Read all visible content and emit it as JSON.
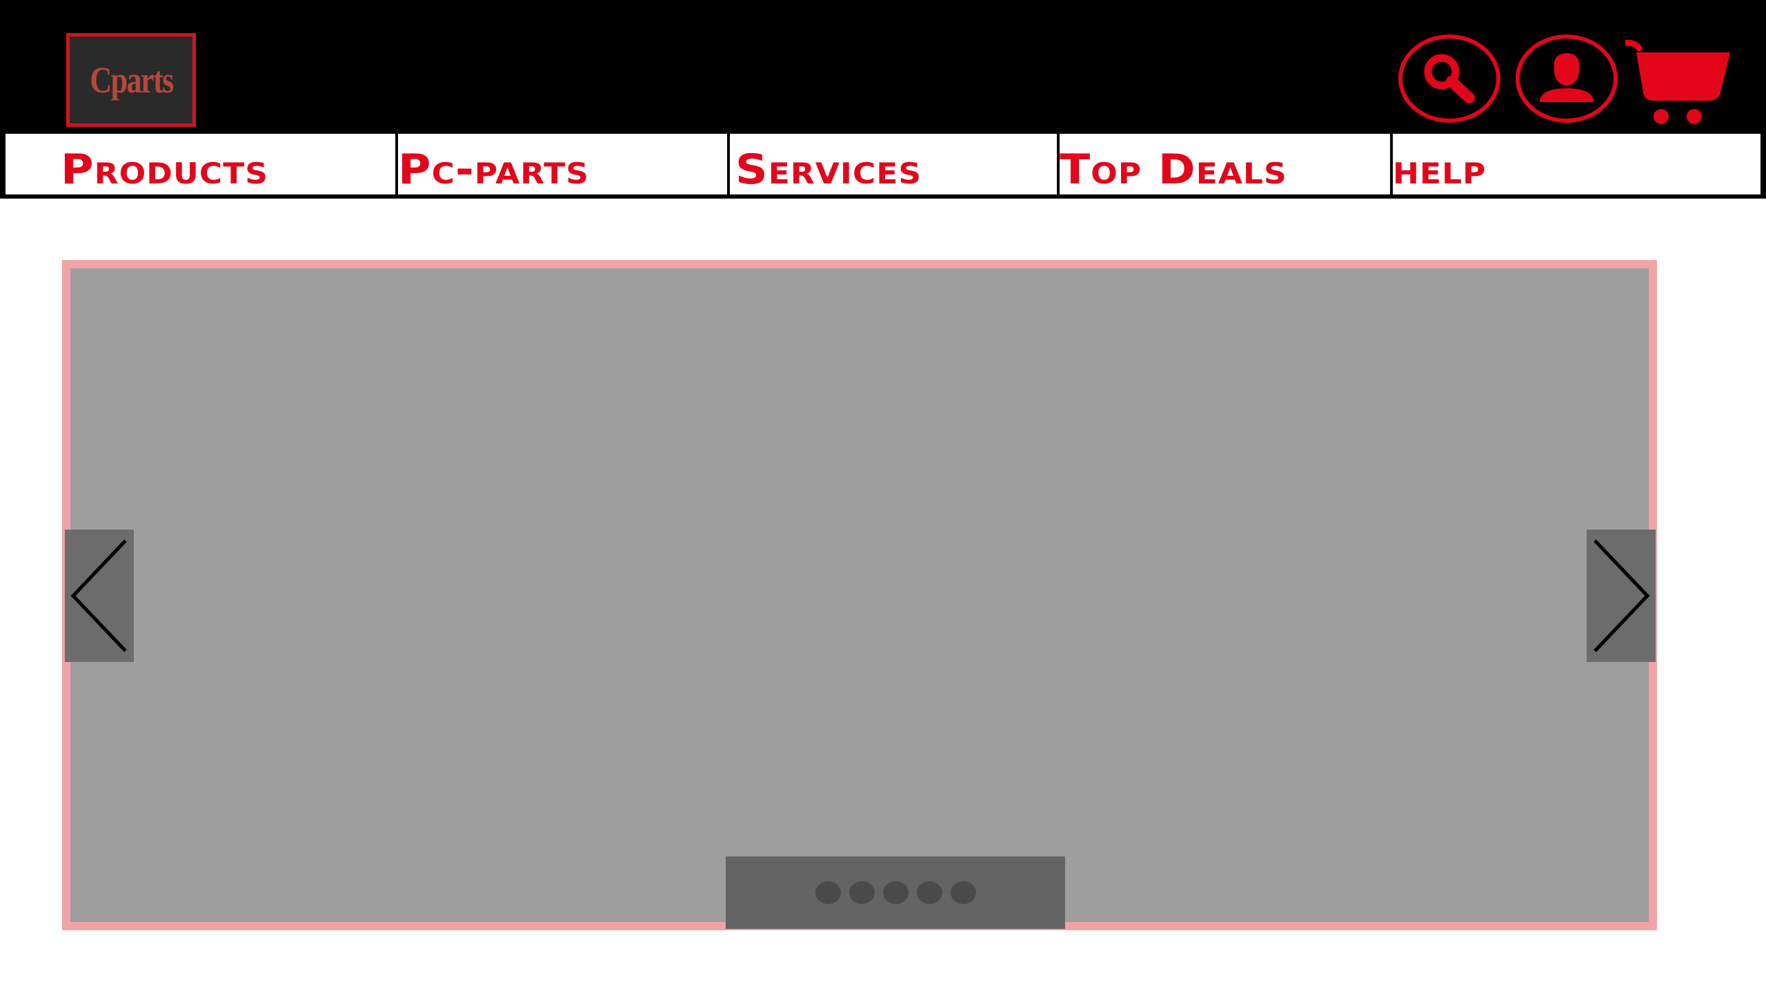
{
  "header": {
    "logo_text": "Cparts",
    "icons": {
      "search": "search-icon",
      "account": "user-account-icon",
      "cart": "shopping-cart-icon"
    }
  },
  "nav": {
    "items": [
      {
        "label": "Products"
      },
      {
        "label": "Pc-parts"
      },
      {
        "label": "Services"
      },
      {
        "label": "Top Deals"
      },
      {
        "label": "help"
      }
    ]
  },
  "carousel": {
    "prev_icon": "chevron-left-icon",
    "next_icon": "chevron-right-icon",
    "slide_count": 5
  },
  "colors": {
    "accent": "#e3061b",
    "header_bg": "#000000",
    "slide_bg": "#9e9e9e",
    "carousel_border": "#f1a3a5"
  }
}
